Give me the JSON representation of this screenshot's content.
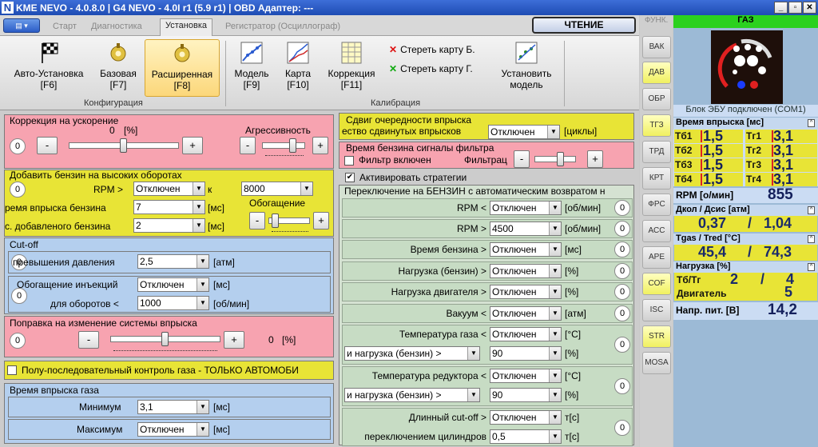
{
  "window": {
    "title": "KME NEVO - 4.0.8.0  |  G4 NEVO - 4.0I r1 (5.9 r1)  |  OBD Адаптер: ---"
  },
  "tabs": [
    "Старт",
    "Диагностика",
    "Установка",
    "Регистратор (Осциллограф)"
  ],
  "read_button": "ЧТЕНИЕ",
  "ribbon": {
    "auto": "Авто-Установка",
    "auto_k": "[F6]",
    "base": "Базовая",
    "base_k": "[F7]",
    "ext": "Расширенная",
    "ext_k": "[F8]",
    "model": "Модель",
    "model_k": "[F9]",
    "map": "Карта",
    "map_k": "[F10]",
    "corr": "Коррекция",
    "corr_k": "[F11]",
    "erase_b": "Стереть карту Б.",
    "erase_g": "Стереть карту Г.",
    "install": "Установить",
    "install2": "модель",
    "grp_conf": "Конфигурация",
    "grp_cal": "Калибрация"
  },
  "side_buttons": [
    "ФУНК.",
    "ВАК",
    "ДАВ",
    "ОБР",
    "ТГЗ",
    "ТРД",
    "КРТ",
    "ФРС",
    "АСС",
    "АРЕ",
    "COF",
    "ISC",
    "STR",
    "MOSA"
  ],
  "accel": {
    "title": "Коррекция на ускорение",
    "value": "0",
    "unit": "[%]",
    "aggr": "Агрессивность",
    "counter": "0"
  },
  "highrpm": {
    "title": "Добавить бензин на высоких оборотах",
    "rpm": "RPM >",
    "rpm_sel": "Отключен",
    "k": "к",
    "k_sel": "8000",
    "inj": "ремя впрыска бензина",
    "inj_sel": "7",
    "inj_u": "[мс]",
    "add": "с. добавленого бензина",
    "add_sel": "2",
    "add_u": "[мс]",
    "enrich": "Обогащение",
    "counter": "0"
  },
  "cutoff": {
    "title": "Cut-off",
    "press": "превышения давления",
    "press_sel": "2,5",
    "press_u": "[атм]",
    "enr": "Обогащение инъекций",
    "enr_sel": "Отключен",
    "enr_u": "[мс]",
    "rpm": "для оборотов <",
    "rpm_sel": "1000",
    "rpm_u": "[об/мин]",
    "c1": "0",
    "c2": "0"
  },
  "fuelsys": {
    "title": "Поправка на изменение системы впрыска",
    "value": "0",
    "unit": "[%]",
    "counter": "0"
  },
  "seq": "Полу-последовательный контроль газа - ТОЛЬКО АВТОМОБИ",
  "gasinj": {
    "title": "Время впрыска газа",
    "min": "Минимум",
    "min_sel": "3,1",
    "min_u": "[мс]",
    "max": "Максимум",
    "max_sel": "Отключен",
    "max_u": "[мс]"
  },
  "shift": {
    "title": "Сдвиг очередности впрыска",
    "lbl": "ество сдвинутых впрысков",
    "sel": "Отключен",
    "u": "[циклы]"
  },
  "filter": {
    "title": "Время бензина сигналы фильтра",
    "cb": "Фильтр включен",
    "lbl": "Фильтрац"
  },
  "activate": "Активировать стратегии",
  "switch_title": "Переключение на БЕНЗИН с автоматическим возвратом н",
  "rows": [
    {
      "l": "RPM <",
      "s": "Отключен",
      "u": "[об/мин]",
      "c": "0"
    },
    {
      "l": "RPM >",
      "s": "4500",
      "u": "[об/мин]",
      "c": "0"
    },
    {
      "l": "Время бензина >",
      "s": "Отключен",
      "u": "[мс]",
      "c": "0"
    },
    {
      "l": "Нагрузка (бензин) >",
      "s": "Отключен",
      "u": "[%]",
      "c": "0"
    },
    {
      "l": "Нагрузка двигателя >",
      "s": "Отключен",
      "u": "[%]",
      "c": "0"
    },
    {
      "l": "Вакуум <",
      "s": "Отключен",
      "u": "[атм]",
      "c": "0"
    }
  ],
  "temp_gas": {
    "l": "Температура газа <",
    "s": "Отключен",
    "u": "[°C]",
    "l2": "и нагрузка (бензин) >",
    "s2": "90",
    "u2": "[%]",
    "c": "0"
  },
  "temp_red": {
    "l": "Температура редуктора <",
    "s": "Отключен",
    "u": "[°C]",
    "l2": "и нагрузка (бензин) >",
    "s2": "90",
    "u2": "[%]",
    "c": "0"
  },
  "longcut": {
    "l": "Длинный cut-off >",
    "s": "Отключен",
    "u": "т[с]",
    "l2": "переключением цилиндров",
    "s2": "0,5",
    "u2": "т[с]",
    "c": "0"
  },
  "panel": {
    "gas": "ГАЗ",
    "ecu": "Блок ЭБУ подключен (COM1)",
    "inj_hdr": "Время впрыска [мс]",
    "tb": [
      {
        "n": "Тб1",
        "v": "1,5"
      },
      {
        "n": "Тб2",
        "v": "1,5"
      },
      {
        "n": "Тб3",
        "v": "1,5"
      },
      {
        "n": "Тб4",
        "v": "1,5"
      }
    ],
    "tg": [
      {
        "n": "Тг1",
        "v": "3,1"
      },
      {
        "n": "Тг2",
        "v": "3,1"
      },
      {
        "n": "Тг3",
        "v": "3,1"
      },
      {
        "n": "Тг4",
        "v": "3,1"
      }
    ],
    "rpm_l": "RPM [о/мин]",
    "rpm": "855",
    "pres_h": "Дкол / Дсис [атм]",
    "pres1": "0,37",
    "sl1": "/",
    "pres2": "1,04",
    "temp_h": "Tgas / Tred [°C]",
    "temp1": "45,4",
    "sl2": "/",
    "temp2": "74,3",
    "load_h": "Нагрузка [%]",
    "load_l": "Тб/Тг",
    "load1": "2",
    "sl3": "/",
    "load2": "4",
    "eng_l": "Двигатель",
    "eng": "5",
    "volt_l": "Напр. пит. [В]",
    "volt": "14,2"
  },
  "colors": {
    "pink": "#f7a3b0",
    "yellow": "#e8e436",
    "blue": "#b4cfee",
    "green": "#c7dcc4",
    "gas_header": "#2bd11e"
  }
}
